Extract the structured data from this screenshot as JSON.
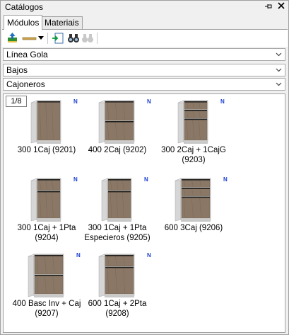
{
  "window": {
    "title": "Catálogos"
  },
  "title_icons": [
    "pin-icon",
    "close-icon"
  ],
  "tabs": [
    {
      "label": "Módulos",
      "active": true
    },
    {
      "label": "Materiais",
      "active": false
    }
  ],
  "toolbar": {
    "buttons": [
      "add-catalog-icon",
      "line-tool-icon",
      "dropdown-arrow-icon",
      "import-icon",
      "binoculars-icon",
      "disabled-binoculars-icon"
    ]
  },
  "filters": {
    "line": "Línea Gola",
    "category": "Bajos",
    "subcategory": "Cajoneros"
  },
  "pagination": {
    "label": "1/8"
  },
  "badge_text": "N",
  "items": [
    {
      "label": "300 1Caj (9201)",
      "drawers": 1,
      "doors": 0,
      "wide": false
    },
    {
      "label": "400 2Caj (9202)",
      "drawers": 2,
      "doors": 0,
      "wide": true
    },
    {
      "label": "300 2Caj + 1CajG (9203)",
      "drawers": 3,
      "doors": 0,
      "wide": false
    },
    {
      "label": "300 1Caj + 1Pta (9204)",
      "drawers": 1,
      "doors": 1,
      "wide": false
    },
    {
      "label": "300 1Caj + 1Pta Especieros (9205)",
      "drawers": 1,
      "doors": 1,
      "wide": false
    },
    {
      "label": "600 3Caj (9206)",
      "drawers": 3,
      "doors": 0,
      "wide": true
    },
    {
      "label": "400 Basc Inv + Caj (9207)",
      "drawers": 2,
      "doors": 0,
      "wide": true
    },
    {
      "label": "600 1Caj + 2Pta (9208)",
      "drawers": 1,
      "doors": 2,
      "wide": true
    }
  ]
}
